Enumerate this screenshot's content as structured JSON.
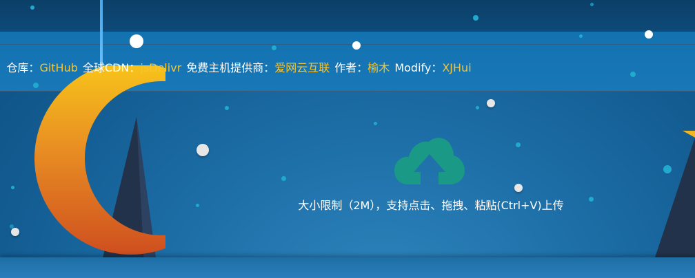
{
  "notice": {
    "fragment_start": "!",
    "repo_label": "仓库：",
    "repo_link": "GitHub",
    "cdn_label": "全球CDN：",
    "cdn_link": "jsDelivr",
    "host_label": "免费主机提供商：",
    "host_link": "爱网云互联",
    "author_label": "作者：",
    "author_link": "榆木",
    "modify_label": "Modify：",
    "modify_link": "XJHui"
  },
  "upload": {
    "icon": "cloud-upload-icon",
    "hint": "大小限制（2M），支持点击、拖拽、粘贴(Ctrl+V)上传"
  },
  "colors": {
    "link": "#f4c534",
    "icon": "#1a9a86",
    "text": "#ffffff",
    "moon_top": "#f6c21d",
    "moon_bottom": "#d1521f"
  }
}
